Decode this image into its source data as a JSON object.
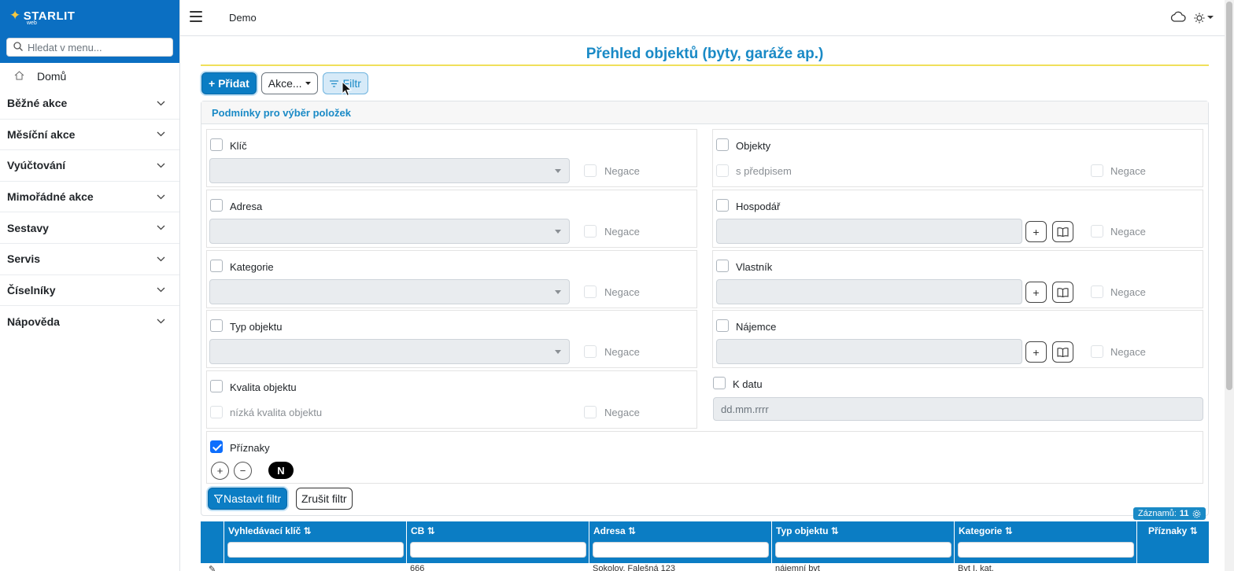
{
  "sidebar": {
    "logo": "STARLIT",
    "logo_sub": "web",
    "search_placeholder": "Hledat v menu...",
    "home": "Domů",
    "items": [
      {
        "label": "Běžné akce"
      },
      {
        "label": "Měsíční akce"
      },
      {
        "label": "Vyúčtování"
      },
      {
        "label": "Mimořádné akce"
      },
      {
        "label": "Sestavy"
      },
      {
        "label": "Servis"
      },
      {
        "label": "Číselníky"
      },
      {
        "label": "Nápověda"
      }
    ]
  },
  "header": {
    "title": "Demo"
  },
  "page": {
    "title": "Přehled objektů (byty, garáže ap.)"
  },
  "toolbar": {
    "add": "+ Přidat",
    "actions": "Akce...",
    "filter": "Filtr"
  },
  "filter": {
    "heading": "Podmínky pro výběr položek",
    "negation": "Negace",
    "key": "Klíč",
    "address": "Adresa",
    "category": "Kategorie",
    "object_type": "Typ objektu",
    "quality": "Kvalita objektu",
    "quality_value": "nízká kvalita objektu",
    "objects": "Objekty",
    "with_prescription": "s předpisem",
    "manager": "Hospodář",
    "owner": "Vlastník",
    "tenant": "Nájemce",
    "to_date": "K datu",
    "date_placeholder": "dd.mm.rrrr",
    "flags": "Příznaky",
    "flag_badge": "N",
    "set": "Nastavit filtr",
    "cancel": "Zrušit filtr"
  },
  "records": {
    "label": "Záznamů:",
    "count": "11"
  },
  "grid": {
    "columns": [
      "Vyhledávací klíč",
      "CB",
      "Adresa",
      "Typ objektu",
      "Kategorie",
      "Příznaky"
    ],
    "row": {
      "cb": "666",
      "address": "Sokolov, Falešná 123",
      "type": "nájemní byt",
      "category": "Byt I. kat."
    }
  },
  "colors": {
    "primary": "#0b7dc4",
    "title": "#1a8ac6",
    "underline": "#f0e05a"
  }
}
